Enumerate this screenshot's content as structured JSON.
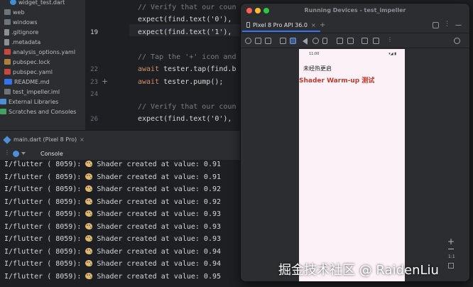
{
  "project_tree": {
    "items": [
      {
        "label": "widget_test.dart",
        "icon": "dart-file-icon"
      },
      {
        "label": "web",
        "icon": "folder-icon"
      },
      {
        "label": "windows",
        "icon": "folder-icon"
      },
      {
        "label": ".gitignore",
        "icon": "file-icon"
      },
      {
        "label": ".metadata",
        "icon": "file-icon"
      },
      {
        "label": "analysis_options.yaml",
        "icon": "yaml-file-icon"
      },
      {
        "label": "pubspec.lock",
        "icon": "lock-file-icon"
      },
      {
        "label": "pubspec.yaml",
        "icon": "yaml-file-icon"
      },
      {
        "label": "README.md",
        "icon": "markdown-file-icon",
        "badge": "M↓"
      },
      {
        "label": "test_impeller.iml",
        "icon": "iml-file-icon"
      },
      {
        "label": "External Libraries",
        "icon": "library-icon"
      },
      {
        "label": "Scratches and Consoles",
        "icon": "scratches-icon"
      }
    ]
  },
  "editor": {
    "line_numbers": [
      "",
      "",
      "",
      "19",
      "",
      "",
      "22",
      "23",
      "24",
      "",
      "26",
      "",
      ""
    ],
    "current_line": "19",
    "lines": [
      {
        "parts": [
          {
            "t": "",
            "c": "fn"
          }
        ]
      },
      {
        "parts": [
          {
            "t": "// Verify that our coun",
            "c": "cmt"
          }
        ]
      },
      {
        "parts": [
          {
            "t": "expect(find.text('0'),",
            "c": "fn"
          }
        ]
      },
      {
        "parts": [
          {
            "t": "expect(find.text('1'),",
            "c": "fn"
          }
        ]
      },
      {
        "parts": [
          {
            "t": "",
            "c": "fn"
          }
        ]
      },
      {
        "parts": [
          {
            "t": "// Tap the '+' icon and",
            "c": "cmt"
          }
        ]
      },
      {
        "parts": [
          {
            "t": "await ",
            "c": "kw"
          },
          {
            "t": "tester.tap(find.b",
            "c": "fn"
          }
        ]
      },
      {
        "parts": [
          {
            "t": "await ",
            "c": "kw"
          },
          {
            "t": "tester.pump();",
            "c": "fn"
          }
        ]
      },
      {
        "parts": [
          {
            "t": "",
            "c": "fn"
          }
        ]
      },
      {
        "parts": [
          {
            "t": "// Verify that our coun",
            "c": "cmt"
          }
        ]
      },
      {
        "parts": [
          {
            "t": "expect(find.text('0'),",
            "c": "fn"
          }
        ]
      }
    ]
  },
  "run": {
    "tab_label": "main.dart (Pixel 8 Pro)",
    "console_label": "Console",
    "logs": [
      {
        "prefix": "I/flutter ( 8059): ",
        "text": " Shader created at value: 0.91"
      },
      {
        "prefix": "I/flutter ( 8059): ",
        "text": " Shader created at value: 0.91"
      },
      {
        "prefix": "I/flutter ( 8059): ",
        "text": " Shader created at value: 0.92"
      },
      {
        "prefix": "I/flutter ( 8059): ",
        "text": " Shader created at value: 0.92"
      },
      {
        "prefix": "I/flutter ( 8059): ",
        "text": " Shader created at value: 0.93"
      },
      {
        "prefix": "I/flutter ( 8059): ",
        "text": " Shader created at value: 0.93"
      },
      {
        "prefix": "I/flutter ( 8059): ",
        "text": " Shader created at value: 0.93"
      },
      {
        "prefix": "I/flutter ( 8059): ",
        "text": " Shader created at value: 0.94"
      },
      {
        "prefix": "I/flutter ( 8059): ",
        "text": " Shader created at value: 0.94"
      },
      {
        "prefix": "I/flutter ( 8059): ",
        "text": " Shader created at value: 0.95"
      }
    ]
  },
  "running_devices": {
    "title": "Running Devices - test_impeller",
    "device_tab": "Pixel 8 Pro API 36.0",
    "phone": {
      "status_time": "11:00",
      "status_right": "▾◢ ▮",
      "text1": "未经热更启",
      "text2": "Shader Warm-up 测试"
    },
    "zoom_ratio": "1:1"
  },
  "watermark": "掘金技术社区 @ RaidenLiu",
  "colors": {
    "accent": "#3574f0",
    "phone_red_text": "#c0392b",
    "traffic_red": "#fe5f57",
    "traffic_yellow": "#febc2e",
    "traffic_green": "#28c840"
  }
}
